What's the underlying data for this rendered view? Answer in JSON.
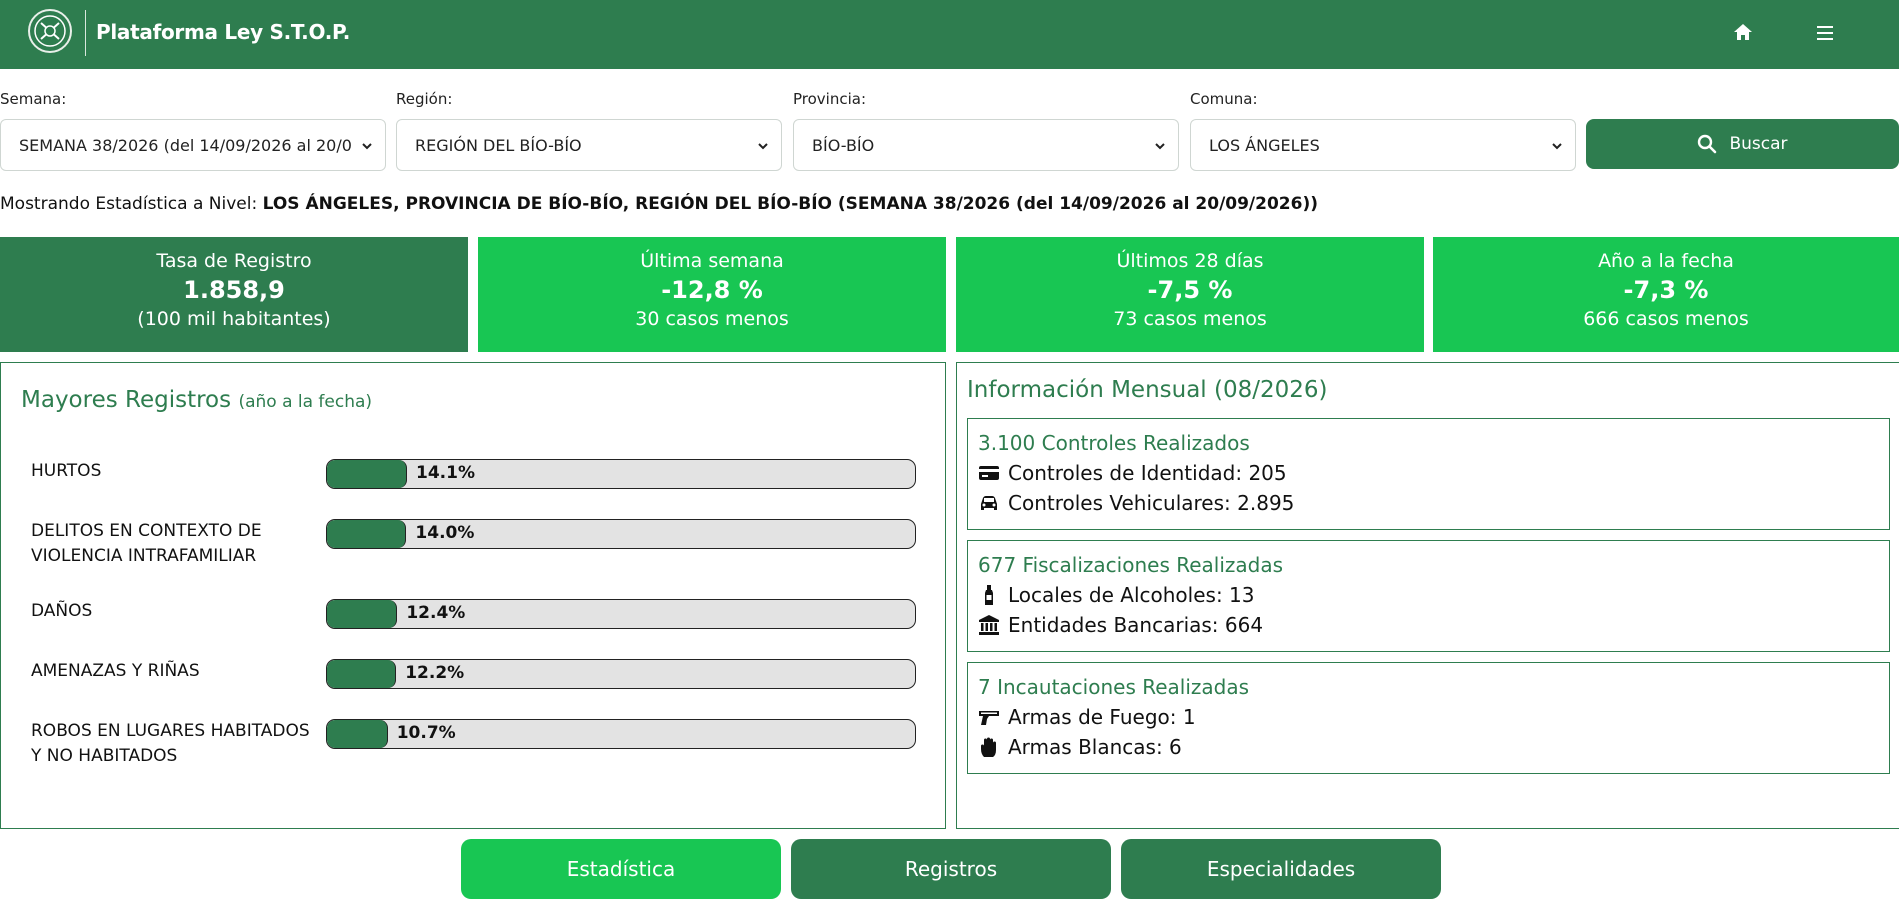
{
  "header": {
    "title": "Plataforma Ley S.T.O.P.",
    "logo_icon": "carabineros-crest-icon",
    "home_icon": "home-icon",
    "menu_icon": "hamburger-menu-icon",
    "bg_color": "#2e7d4f"
  },
  "filters": {
    "semana": {
      "label": "Semana:",
      "value": "SEMANA 38/2026 (del 14/09/2026 al 20/0"
    },
    "region": {
      "label": "Región:",
      "value": "REGIÓN DEL BÍO-BÍO"
    },
    "provincia": {
      "label": "Provincia:",
      "value": "BÍO-BÍO"
    },
    "comuna": {
      "label": "Comuna:",
      "value": "LOS ÁNGELES"
    },
    "search_label": "Buscar"
  },
  "level": {
    "prefix": "Mostrando Estadística a Nivel: ",
    "value": "LOS ÁNGELES, PROVINCIA DE BÍO-BÍO, REGIÓN DEL BÍO-BÍO (SEMANA 38/2026 (del 14/09/2026 al 20/09/2026))"
  },
  "kpis": [
    {
      "title": "Tasa de Registro",
      "value": "1.858,9",
      "sub": "(100 mil habitantes)",
      "color": "#2e7d4f"
    },
    {
      "title": "Última semana",
      "value": "-12,8 %",
      "sub": "30 casos menos",
      "color": "#18c653"
    },
    {
      "title": "Últimos 28 días",
      "value": "-7,5 %",
      "sub": "73 casos menos",
      "color": "#18c653"
    },
    {
      "title": "Año a la fecha",
      "value": "-7,3 %",
      "sub": "666 casos menos",
      "color": "#18c653"
    }
  ],
  "mayores": {
    "title": "Mayores Registros",
    "subtitle": "(año a la fecha)",
    "items": [
      {
        "label": "HURTOS",
        "percent": 14.1,
        "text": "14.1%"
      },
      {
        "label": "DELITOS EN CONTEXTO DE VIOLENCIA INTRAFAMILIAR",
        "percent": 14.0,
        "text": "14.0%"
      },
      {
        "label": "DAÑOS",
        "percent": 12.4,
        "text": "12.4%"
      },
      {
        "label": "AMENAZAS Y RIÑAS",
        "percent": 12.2,
        "text": "12.2%"
      },
      {
        "label": "ROBOS EN LUGARES HABITADOS Y NO HABITADOS",
        "percent": 10.7,
        "text": "10.7%"
      }
    ]
  },
  "mensual": {
    "title": "Información Mensual (08/2026)",
    "controles": {
      "title": "3.100 Controles Realizados",
      "lines": [
        {
          "icon": "id-card-icon",
          "text": "Controles de Identidad: 205"
        },
        {
          "icon": "car-icon",
          "text": "Controles Vehiculares: 2.895"
        }
      ]
    },
    "fiscalizaciones": {
      "title": "677 Fiscalizaciones Realizadas",
      "lines": [
        {
          "icon": "bottle-icon",
          "text": "Locales de Alcoholes: 13"
        },
        {
          "icon": "bank-icon",
          "text": "Entidades Bancarias: 664"
        }
      ]
    },
    "incautaciones": {
      "title": "7 Incautaciones Realizadas",
      "lines": [
        {
          "icon": "gun-icon",
          "text": "Armas de Fuego: 1"
        },
        {
          "icon": "hand-icon",
          "text": "Armas Blancas: 6"
        }
      ]
    }
  },
  "tabs": [
    {
      "label": "Estadística",
      "active": true,
      "color": "#18c653"
    },
    {
      "label": "Registros",
      "active": false,
      "color": "#2e7d4f"
    },
    {
      "label": "Especialidades",
      "active": false,
      "color": "#2e7d4f"
    }
  ]
}
